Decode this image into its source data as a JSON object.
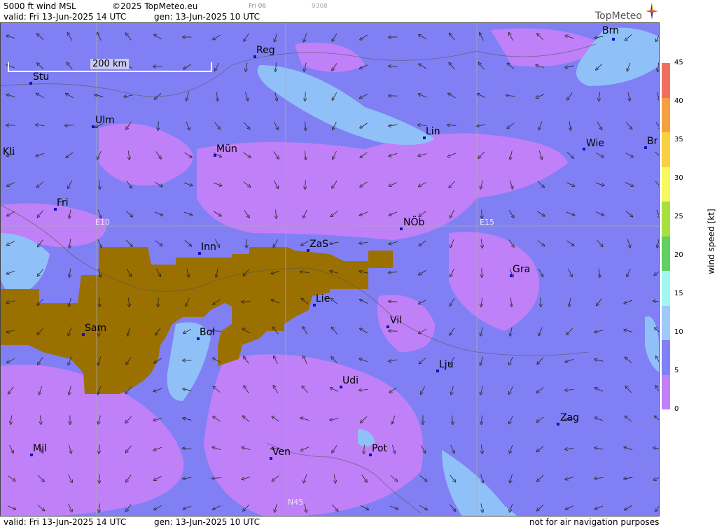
{
  "header": {
    "product": "5000 ft wind MSL",
    "copyright": "©2025 TopMeteo.eu",
    "daycode": "Fri 06",
    "code": "9308",
    "valid": "valid:  Fri  13-Jun-2025  14 UTC",
    "gen": "gen: 13-Jun-2025 10 UTC",
    "logo": "TopMeteo"
  },
  "footer": {
    "valid": "valid:  Fri  13-Jun-2025  14 UTC",
    "gen": "gen: 13-Jun-2025 10 UTC",
    "note": "not for air navigation purposes"
  },
  "scale": {
    "label": "200 km"
  },
  "grid_labels": {
    "e10": "E10",
    "e15": "E15",
    "n45": "N45"
  },
  "cities": [
    {
      "name": "Brn"
    },
    {
      "name": "Reg"
    },
    {
      "name": "Stu"
    },
    {
      "name": "Ulm"
    },
    {
      "name": "Lin"
    },
    {
      "name": "Kli"
    },
    {
      "name": "Mün"
    },
    {
      "name": "Wie"
    },
    {
      "name": "Br"
    },
    {
      "name": "Fri"
    },
    {
      "name": "NÖb"
    },
    {
      "name": "Inn"
    },
    {
      "name": "ZaS"
    },
    {
      "name": "Gra"
    },
    {
      "name": "Lie"
    },
    {
      "name": "Vil"
    },
    {
      "name": "Sam"
    },
    {
      "name": "Bol"
    },
    {
      "name": "Lju"
    },
    {
      "name": "Udi"
    },
    {
      "name": "Zag"
    },
    {
      "name": "Mil"
    },
    {
      "name": "Pot"
    },
    {
      "name": "Ven"
    }
  ],
  "legend": {
    "title": "wind  speed  [kt]",
    "ticks": [
      "45",
      "40",
      "35",
      "30",
      "25",
      "20",
      "15",
      "10",
      "5",
      "0"
    ],
    "colors": [
      "#f07060",
      "#f4a040",
      "#f8d040",
      "#f8f860",
      "#a8e040",
      "#60d060",
      "#a0f8f0",
      "#a0c8f8",
      "#8080f8",
      "#c080f8"
    ]
  },
  "map_colors": {
    "base": "#8080f4",
    "light_purple": "#c080f8",
    "light_blue": "#90c0f8",
    "terrain": "#9a7000"
  }
}
